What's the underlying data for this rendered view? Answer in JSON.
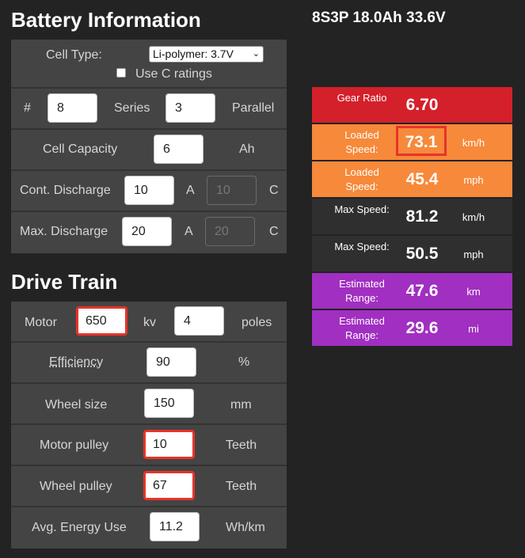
{
  "battery": {
    "title": "Battery Information",
    "summary": "8S3P 18.0Ah 33.6V",
    "cell_type_label": "Cell Type:",
    "cell_type_value": "Li-polymer: 3.7V",
    "use_c_label": "Use C ratings",
    "series_hash": "#",
    "series_value": "8",
    "series_label": "Series",
    "parallel_value": "3",
    "parallel_label": "Parallel",
    "capacity_label": "Cell Capacity",
    "capacity_value": "6",
    "capacity_unit": "Ah",
    "cont_label": "Cont. Discharge",
    "cont_value": "10",
    "cont_unit_a": "A",
    "cont_c_value": "10",
    "cont_unit_c": "C",
    "max_label": "Max. Discharge",
    "max_value": "20",
    "max_unit_a": "A",
    "max_c_value": "20",
    "max_unit_c": "C"
  },
  "drive": {
    "title": "Drive Train",
    "motor_label": "Motor",
    "motor_kv": "650",
    "kv_label": "kv",
    "poles_value": "4",
    "poles_label": "poles",
    "eff_label": "Efficiency",
    "eff_value": "90",
    "eff_unit": "%",
    "wheel_label": "Wheel size",
    "wheel_value": "150",
    "wheel_unit": "mm",
    "mpulley_label": "Motor pulley",
    "mpulley_value": "10",
    "mpulley_unit": "Teeth",
    "wpulley_label": "Wheel pulley",
    "wpulley_value": "67",
    "wpulley_unit": "Teeth",
    "energy_label": "Avg. Energy Use",
    "energy_value": "11.2",
    "energy_unit": "Wh/km"
  },
  "results": [
    {
      "label": "Gear Ratio",
      "value": "6.70",
      "unit": "",
      "color": "#d4202a",
      "boxed": false
    },
    {
      "label": "Loaded Speed:",
      "value": "73.1",
      "unit": "km/h",
      "color": "#f7893a",
      "boxed": true
    },
    {
      "label": "Loaded Speed:",
      "value": "45.4",
      "unit": "mph",
      "color": "#f7893a",
      "boxed": false
    },
    {
      "label": "Max Speed:",
      "value": "81.2",
      "unit": "km/h",
      "color": "#2f2f2f",
      "boxed": false
    },
    {
      "label": "Max Speed:",
      "value": "50.5",
      "unit": "mph",
      "color": "#2f2f2f",
      "boxed": false
    },
    {
      "label": "Estimated Range:",
      "value": "47.6",
      "unit": "km",
      "color": "#a12fc1",
      "boxed": false
    },
    {
      "label": "Estimated Range:",
      "value": "29.6",
      "unit": "mi",
      "color": "#a12fc1",
      "boxed": false
    }
  ]
}
